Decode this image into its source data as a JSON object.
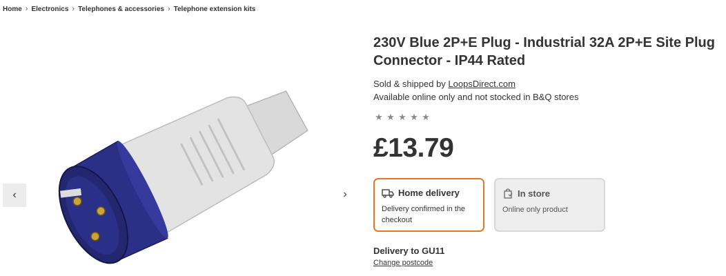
{
  "breadcrumb": [
    "Home",
    "Electronics",
    "Telephones & accessories",
    "Telephone extension kits"
  ],
  "product": {
    "title": "230V Blue 2P+E Plug - Industrial 32A 2P+E Site Plug Connector - IP44 Rated",
    "sold_by_prefix": "Sold & shipped by",
    "seller": "LoopsDirect.com",
    "availability": "Available online only and not stocked in B&Q stores",
    "rating": 0,
    "rating_max": 5,
    "price": "£13.79"
  },
  "delivery": {
    "home": {
      "label": "Home delivery",
      "description": "Delivery confirmed in the checkout",
      "selected": true
    },
    "store": {
      "label": "In store",
      "description": "Online only product",
      "selected": false
    },
    "delivery_to": "Delivery to GU11",
    "change_postcode": "Change postcode"
  },
  "gallery": {
    "prev_icon": "chevron-left-icon",
    "next_icon": "chevron-right-icon"
  },
  "colors": {
    "accent": "#e87722",
    "plug_blue": "#2b2f85",
    "plug_grey": "#dcdcdc"
  }
}
